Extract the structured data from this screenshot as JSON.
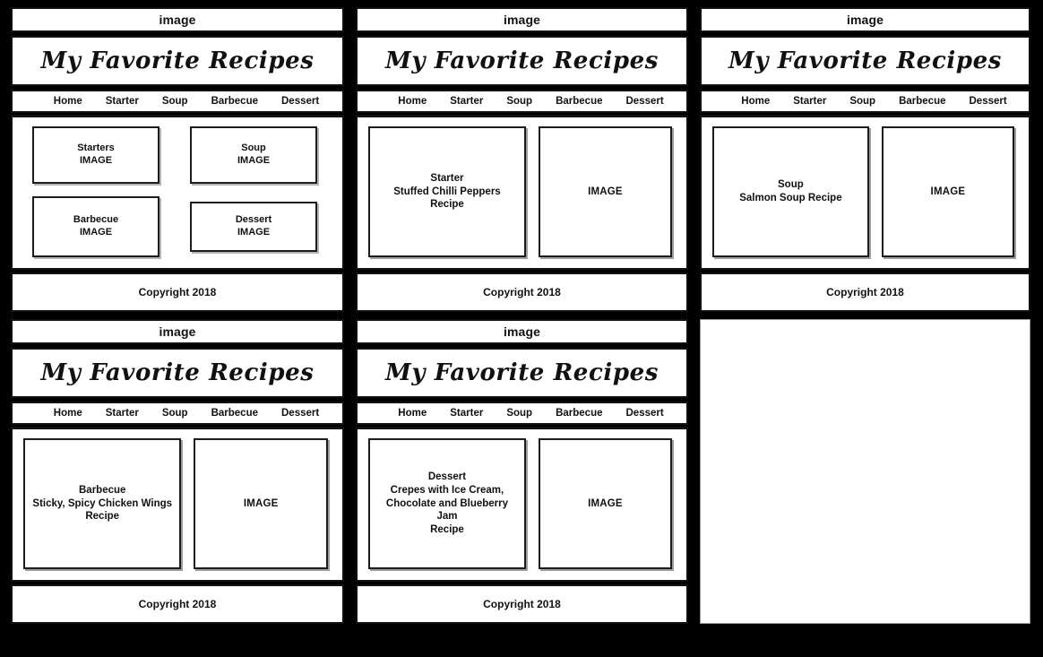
{
  "board": {
    "background_color": "#000000",
    "panel_background": "#ffffff",
    "ink_color": "#111111"
  },
  "shared": {
    "image_bar_label": "image",
    "site_title": "My Favorite Recipes",
    "footer_label": "Copyright 2018",
    "image_placeholder_label": "IMAGE",
    "nav": [
      {
        "label": "Home"
      },
      {
        "label": "Starter"
      },
      {
        "label": "Soup"
      },
      {
        "label": "Barbecue"
      },
      {
        "label": "Dessert"
      }
    ]
  },
  "panels": [
    {
      "id": "home",
      "kind": "tile-grid",
      "tiles": [
        {
          "title": "Starters",
          "subtitle": "IMAGE"
        },
        {
          "title": "Soup",
          "subtitle": "IMAGE"
        },
        {
          "title": "Barbecue",
          "subtitle": "IMAGE"
        },
        {
          "title": "Dessert",
          "subtitle": "IMAGE"
        }
      ]
    },
    {
      "id": "starter",
      "kind": "recipe",
      "caption": "Starter\nStuffed Chilli Peppers Recipe",
      "image_label": "IMAGE"
    },
    {
      "id": "soup",
      "kind": "recipe",
      "caption": "Soup\nSalmon Soup Recipe",
      "image_label": "IMAGE"
    },
    {
      "id": "barbecue",
      "kind": "recipe",
      "caption": "Barbecue\nSticky, Spicy Chicken Wings\nRecipe",
      "image_label": "IMAGE"
    },
    {
      "id": "dessert",
      "kind": "recipe",
      "caption": "Dessert\nCrepes with Ice Cream,\nChocolate and Blueberry Jam\nRecipe",
      "image_label": "IMAGE"
    },
    {
      "id": "blank",
      "kind": "blank"
    }
  ]
}
